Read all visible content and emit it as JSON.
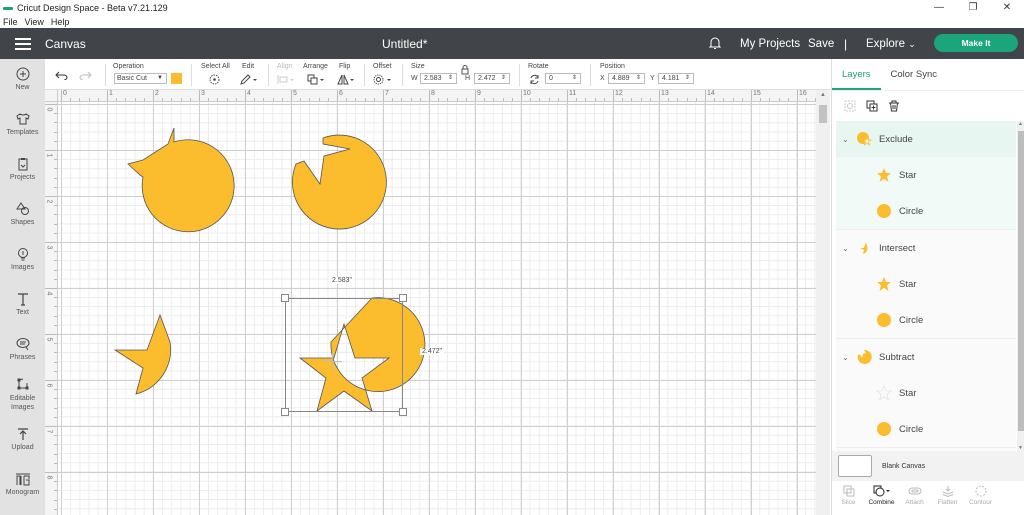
{
  "window": {
    "title": "Cricut Design Space - Beta v7.21.129",
    "controls": [
      "minimize",
      "restore",
      "close"
    ]
  },
  "menubar": [
    "File",
    "View",
    "Help"
  ],
  "header": {
    "section": "Canvas",
    "document_title": "Untitled*",
    "my_projects": "My Projects",
    "save": "Save",
    "separator": "|",
    "explore": "Explore",
    "make_it": "Make It",
    "accent_color": "#1aa57a",
    "bg_color": "#414549"
  },
  "leftbar": [
    {
      "label": "New",
      "icon": "plus-circle-icon"
    },
    {
      "label": "Templates",
      "icon": "shirt-icon"
    },
    {
      "label": "Projects",
      "icon": "clipboard-icon"
    },
    {
      "label": "Shapes",
      "icon": "shapes-icon"
    },
    {
      "label": "Images",
      "icon": "lightbulb-icon"
    },
    {
      "label": "Text",
      "icon": "text-icon"
    },
    {
      "label": "Phrases",
      "icon": "speech-bubble-icon"
    },
    {
      "label": "Editable Images",
      "icon": "editable-images-icon"
    },
    {
      "label": "Upload",
      "icon": "upload-icon"
    },
    {
      "label": "Monogram",
      "icon": "monogram-icon"
    }
  ],
  "toolbar": {
    "operation_label": "Operation",
    "operation_value": "Basic Cut",
    "swatch_color": "#fbbc2e",
    "select_all": "Select All",
    "edit": "Edit",
    "align": "Align",
    "arrange": "Arrange",
    "flip": "Flip",
    "offset": "Offset",
    "size_label": "Size",
    "w_label": "W",
    "w_value": "2.583",
    "h_label": "H",
    "h_value": "2.472",
    "rotate_label": "Rotate",
    "rotate_value": "0",
    "position_label": "Position",
    "x_label": "X",
    "x_value": "4.889",
    "y_label": "Y",
    "y_value": "4.181"
  },
  "rulers": {
    "top": [
      "0",
      "1",
      "2",
      "3",
      "4",
      "5",
      "6",
      "7",
      "8",
      "9",
      "10",
      "11",
      "12",
      "13",
      "14",
      "15",
      "16"
    ],
    "left": [
      "0",
      "1",
      "2",
      "3",
      "4",
      "5",
      "6",
      "7",
      "8"
    ]
  },
  "canvas": {
    "shape_color": "#fbbc2e",
    "selection_width_label": "2.583\"",
    "selection_height_label": "2.472\""
  },
  "panel": {
    "tabs": [
      {
        "label": "Layers",
        "active": true
      },
      {
        "label": "Color Sync",
        "active": false
      }
    ],
    "tools": [
      "ungroup-icon",
      "duplicate-icon",
      "delete-icon"
    ],
    "groups": [
      {
        "name": "Exclude",
        "icon": "exclude-shape-icon",
        "selected": true,
        "children": [
          {
            "name": "Star",
            "icon": "star-icon"
          },
          {
            "name": "Circle",
            "icon": "circle-icon"
          }
        ]
      },
      {
        "name": "Intersect",
        "icon": "intersect-shape-icon",
        "selected": false,
        "children": [
          {
            "name": "Star",
            "icon": "star-icon"
          },
          {
            "name": "Circle",
            "icon": "circle-icon"
          }
        ]
      },
      {
        "name": "Subtract",
        "icon": "subtract-shape-icon",
        "selected": false,
        "children": [
          {
            "name": "Star",
            "icon": "star-outline-icon"
          },
          {
            "name": "Circle",
            "icon": "circle-icon"
          }
        ]
      }
    ],
    "blank_canvas": "Blank Canvas",
    "bottom_tools": [
      {
        "label": "Slice",
        "enabled": false
      },
      {
        "label": "Combine",
        "enabled": true
      },
      {
        "label": "Attach",
        "enabled": false
      },
      {
        "label": "Flatten",
        "enabled": false
      },
      {
        "label": "Contour",
        "enabled": false
      }
    ]
  }
}
